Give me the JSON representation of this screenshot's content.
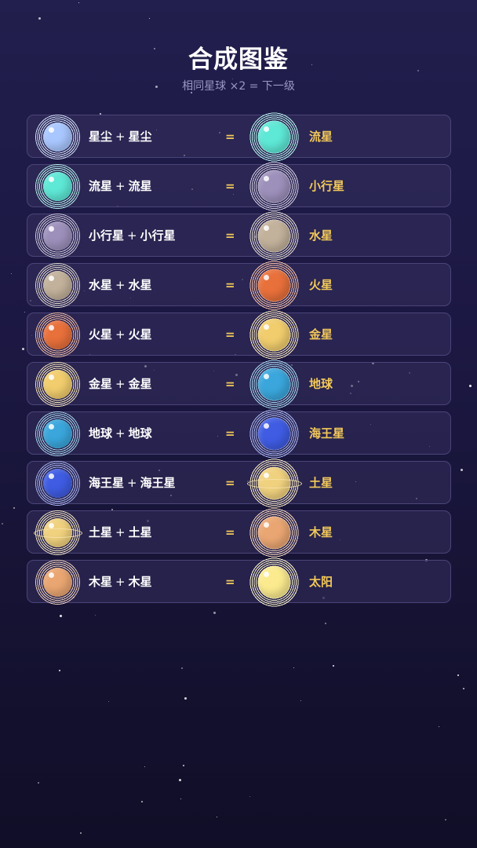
{
  "header": {
    "title": "合成图鉴",
    "subtitle": "相同星球 ×2 = 下一级"
  },
  "equals_sign": "=",
  "plus_sign": "+",
  "recipes": [
    {
      "input": "星尘",
      "output": "流星",
      "input_color": "#a9c7ff",
      "output_color": "#5ee8d6",
      "input_icon": "stardust-icon",
      "output_icon": "meteor-icon",
      "input_rings": false,
      "output_rings": false
    },
    {
      "input": "流星",
      "output": "小行星",
      "input_color": "#5ee8d6",
      "output_color": "#9d90bb",
      "input_icon": "meteor-icon",
      "output_icon": "asteroid-icon",
      "input_rings": false,
      "output_rings": false
    },
    {
      "input": "小行星",
      "output": "水星",
      "input_color": "#9d90bb",
      "output_color": "#c2b19b",
      "input_icon": "asteroid-icon",
      "output_icon": "mercury-icon",
      "input_rings": false,
      "output_rings": false
    },
    {
      "input": "水星",
      "output": "火星",
      "input_color": "#c2b19b",
      "output_color": "#e8703b",
      "input_icon": "mercury-icon",
      "output_icon": "mars-icon",
      "input_rings": false,
      "output_rings": false
    },
    {
      "input": "火星",
      "output": "金星",
      "input_color": "#e8703b",
      "output_color": "#f1cd6d",
      "input_icon": "mars-icon",
      "output_icon": "venus-icon",
      "input_rings": false,
      "output_rings": false
    },
    {
      "input": "金星",
      "output": "地球",
      "input_color": "#f1cd6d",
      "output_color": "#3aa6dc",
      "input_icon": "venus-icon",
      "output_icon": "earth-icon",
      "input_rings": false,
      "output_rings": false
    },
    {
      "input": "地球",
      "output": "海王星",
      "input_color": "#3aa6dc",
      "output_color": "#3f5ce3",
      "input_icon": "earth-icon",
      "output_icon": "neptune-icon",
      "input_rings": false,
      "output_rings": false
    },
    {
      "input": "海王星",
      "output": "土星",
      "input_color": "#3f5ce3",
      "output_color": "#f0d17e",
      "input_icon": "neptune-icon",
      "output_icon": "saturn-icon",
      "input_rings": false,
      "output_rings": true
    },
    {
      "input": "土星",
      "output": "木星",
      "input_color": "#f0d17e",
      "output_color": "#eaa672",
      "input_icon": "saturn-icon",
      "output_icon": "jupiter-icon",
      "input_rings": true,
      "output_rings": false
    },
    {
      "input": "木星",
      "output": "太阳",
      "input_color": "#eaa672",
      "output_color": "#fbeb8e",
      "input_icon": "jupiter-icon",
      "output_icon": "sun-icon",
      "input_rings": false,
      "output_rings": false
    }
  ]
}
